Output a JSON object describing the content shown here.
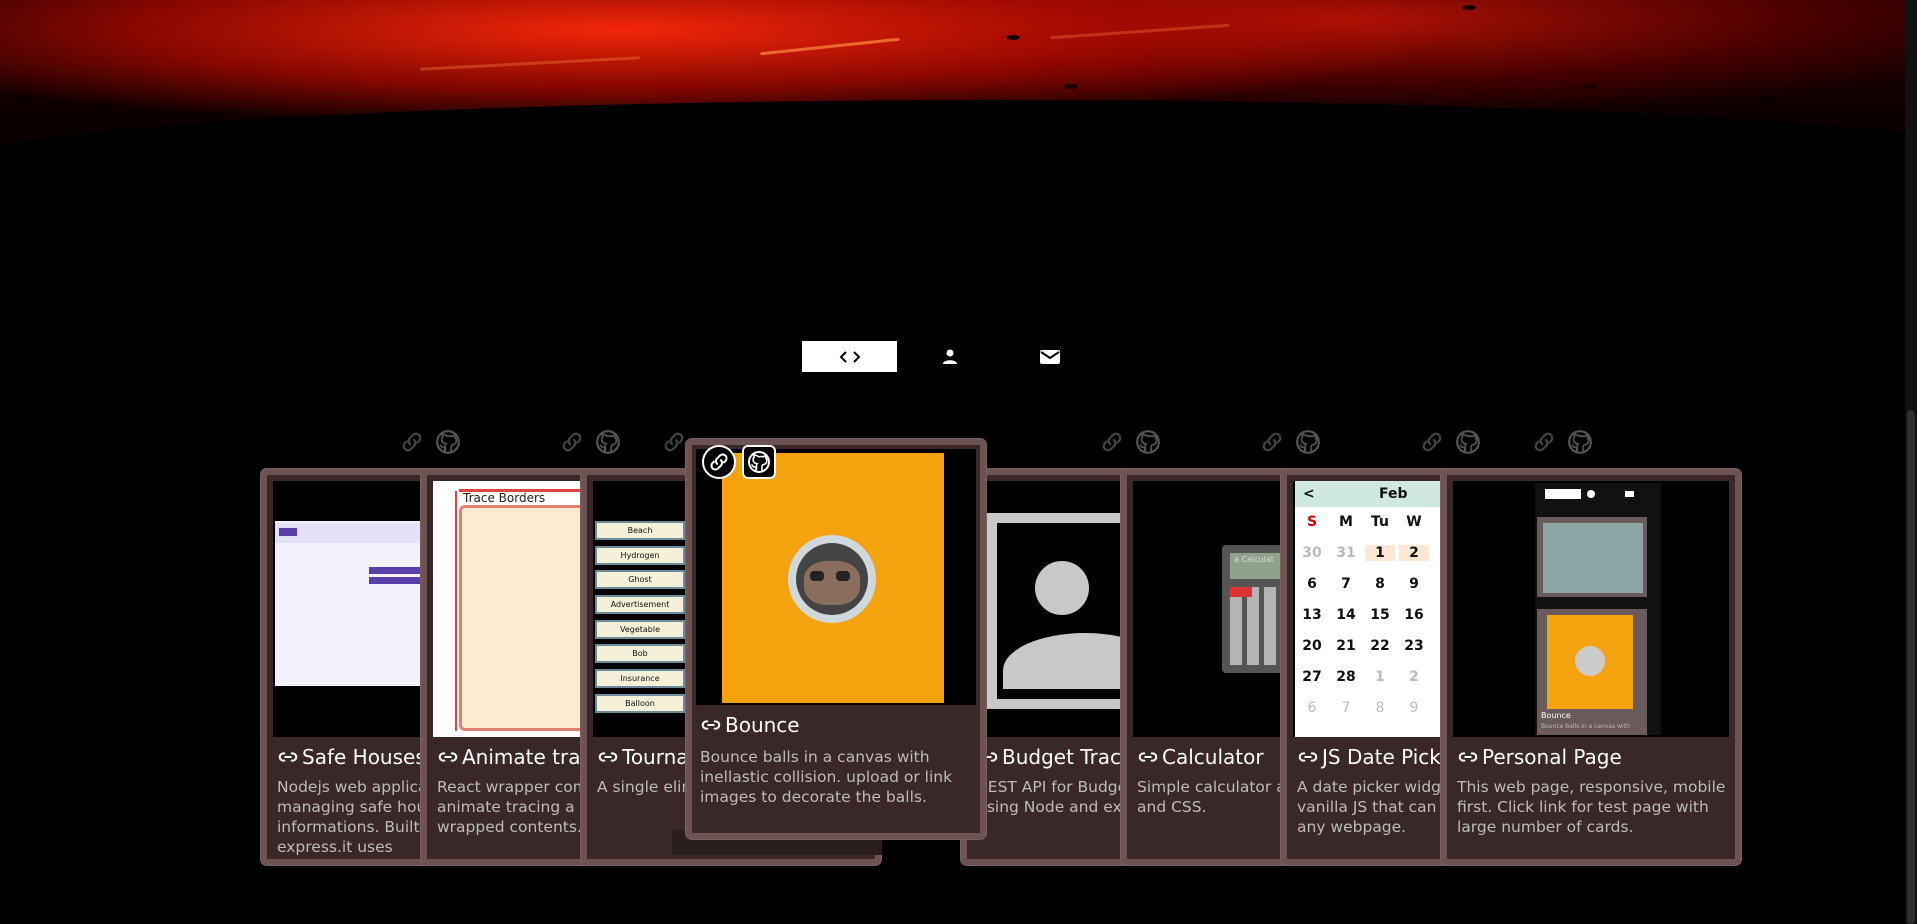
{
  "nav": {
    "tabs": [
      {
        "icon": "code-icon",
        "active": true
      },
      {
        "icon": "person-icon",
        "active": false
      },
      {
        "icon": "mail-icon",
        "active": false
      }
    ]
  },
  "projects": [
    {
      "title": "Safe Houses",
      "description": "Nodejs web applica managing safe hou informations. Built and express.it uses"
    },
    {
      "title": "Animate trac",
      "description": "React wrapper com animate tracing a b wrapped contents."
    },
    {
      "title": "Tourna",
      "description": "A single elim generator m"
    },
    {
      "title": "Budget Track",
      "description": "REST API for Budge using Node and exp"
    },
    {
      "title": "Calculator",
      "description": "Simple calculator ap and CSS."
    },
    {
      "title": "JS Date Picke",
      "description": "A date picker widge vanilla JS that can e to any webpage."
    },
    {
      "title": "Personal Page",
      "description": "This web page, responsive, mobile first. Click link for test page with large number of cards."
    }
  ],
  "featured": {
    "title": "Bounce",
    "description": "Bounce balls in a canvas with inellastic collision. upload or link images to decorate the balls."
  },
  "thumbs": {
    "animate": {
      "label": "Trace Borders"
    },
    "tournament": {
      "items": [
        "Beach",
        "Hydrogen",
        "Ghost",
        "Advertisement",
        "Vegetable",
        "Bob",
        "Insurance",
        "Balloon"
      ]
    },
    "calendar": {
      "prev": "<",
      "month": "Feb",
      "days": [
        "S",
        "M",
        "Tu",
        "W"
      ],
      "rows": [
        [
          "30",
          "31",
          "1",
          "2"
        ],
        [
          "6",
          "7",
          "8",
          "9"
        ],
        [
          "13",
          "14",
          "15",
          "16"
        ],
        [
          "20",
          "21",
          "22",
          "23"
        ],
        [
          "27",
          "28",
          "1",
          "2"
        ],
        [
          "6",
          "7",
          "8",
          "9"
        ]
      ]
    },
    "calculator": {
      "label": "a Calculat"
    },
    "personal": {
      "mini_title": "Bounce",
      "mini_desc": "Bounce balls in a canvas with"
    }
  },
  "colors": {
    "card_border": "#6d5354",
    "card_bg": "#3a2828",
    "bounce_bg": "#f4a30f"
  }
}
